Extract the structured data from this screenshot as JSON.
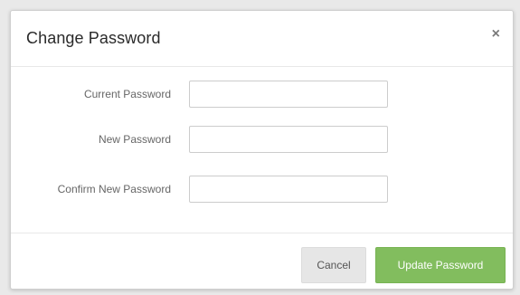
{
  "dialog": {
    "title": "Change Password",
    "close_glyph": "×"
  },
  "form": {
    "fields": [
      {
        "label": "Current Password",
        "value": "",
        "placeholder": ""
      },
      {
        "label": "New Password",
        "value": "",
        "placeholder": ""
      },
      {
        "label": "Confirm New Password",
        "value": "",
        "placeholder": ""
      }
    ]
  },
  "footer": {
    "cancel_label": "Cancel",
    "submit_label": "Update Password"
  },
  "colors": {
    "submit_background": "#82bd5e",
    "cancel_background": "#e6e6e6"
  },
  "icons": {
    "close": "close-icon"
  }
}
